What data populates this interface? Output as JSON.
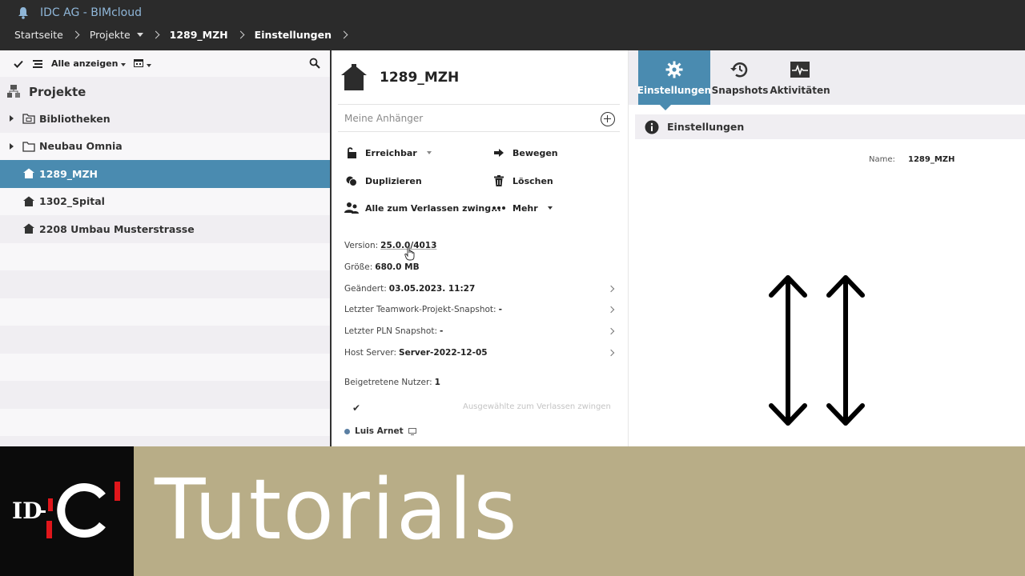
{
  "app": {
    "title": "IDC AG - BIMcloud"
  },
  "breadcrumb": [
    "Startseite",
    "Projekte",
    "1289_MZH",
    "Einstellungen"
  ],
  "left": {
    "filter_label": "Alle anzeigen",
    "heading": "Projekte",
    "items": [
      {
        "label": "Bibliotheken",
        "type": "library-folder",
        "expandable": true,
        "selected": false
      },
      {
        "label": "Neubau Omnia",
        "type": "folder",
        "expandable": true,
        "selected": false
      },
      {
        "label": "1289_MZH",
        "type": "project",
        "expandable": false,
        "selected": true
      },
      {
        "label": "1302_Spital",
        "type": "project",
        "expandable": false,
        "selected": false
      },
      {
        "label": "2208 Umbau Musterstrasse",
        "type": "project",
        "expandable": false,
        "selected": false
      }
    ]
  },
  "center": {
    "project_name": "1289_MZH",
    "attachments_placeholder": "Meine Anhänger",
    "actions": {
      "reachable": "Erreichbar",
      "move": "Bewegen",
      "duplicate": "Duplizieren",
      "delete": "Löschen",
      "force_leave_all": "Alle zum Verlassen zwing...",
      "more": "Mehr"
    },
    "info": {
      "version_label": "Version:",
      "version_value": "25.0.0/4013",
      "size_label": "Größe:",
      "size_value": "680.0 MB",
      "changed_label": "Geändert:",
      "changed_value": "03.05.2023. 11:27",
      "teamwork_snapshot_label": "Letzter Teamwork-Projekt-Snapshot:",
      "teamwork_snapshot_value": "-",
      "pln_snapshot_label": "Letzter PLN Snapshot:",
      "pln_snapshot_value": "-",
      "host_label": "Host Server:",
      "host_value": "Server-2022-12-05",
      "joined_label": "Beigetretene Nutzer:",
      "joined_value": "1"
    },
    "force_selected_label": "Ausgewählte zum Verlassen zwingen",
    "user_name": "Luis Arnet"
  },
  "right": {
    "tabs": [
      {
        "label": "Einstellungen",
        "active": true
      },
      {
        "label": "Snapshots",
        "active": false
      },
      {
        "label": "Aktivitäten",
        "active": false
      }
    ],
    "section_title": "Einstellungen",
    "name_label": "Name:",
    "name_value": "1289_MZH"
  },
  "banner": {
    "text": "Tutorials",
    "logo_text": "ID-C"
  },
  "colors": {
    "accent": "#4a8bb0",
    "topbar": "#2b2b2b",
    "banner": "#b8ad87"
  }
}
